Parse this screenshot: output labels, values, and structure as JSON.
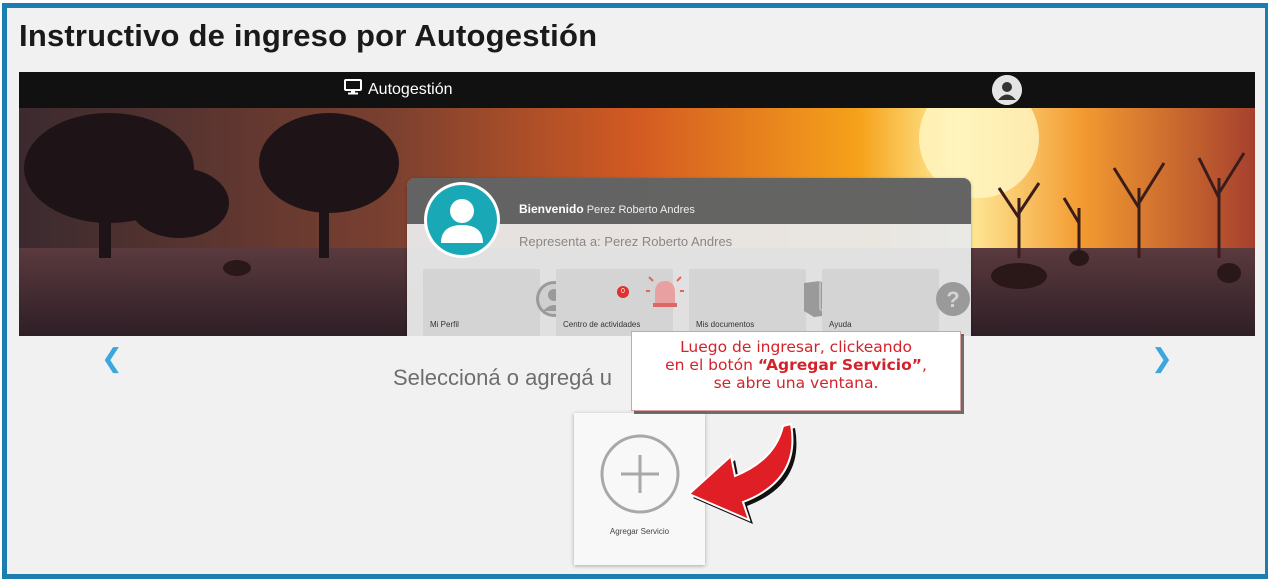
{
  "doc": {
    "title": "Instructivo de ingreso por Autogestión"
  },
  "topbar": {
    "brand": "Autogestión"
  },
  "profile": {
    "welcome": "Bienvenido",
    "name": "Perez Roberto Andres",
    "represents": "Representa a: Perez Roberto Andres"
  },
  "tiles": [
    {
      "label": "Mi Perfil",
      "icon": "user-circle-icon"
    },
    {
      "label": "Centro de actividades",
      "icon": "alarm-bell-icon",
      "badge": "0"
    },
    {
      "label": "Mis documentos",
      "icon": "book-icon"
    },
    {
      "label": "Ayuda",
      "icon": "question-icon"
    }
  ],
  "main": {
    "select_text": "Seleccioná o agregá u",
    "add_service_label": "Agregar Servicio"
  },
  "callout": {
    "line1": "Luego de ingresar, clickeando",
    "line2_pre": "en el botón ",
    "line2_bold": "“Agregar Servicio”",
    "line2_post": ",",
    "line3": "se abre una ventana."
  },
  "colors": {
    "frame_border": "#1b7db0",
    "avatar_bg": "#19a8b6",
    "nav_arrow": "#3ea6de",
    "callout_text": "#d3232a",
    "badge": "#e0312e"
  }
}
